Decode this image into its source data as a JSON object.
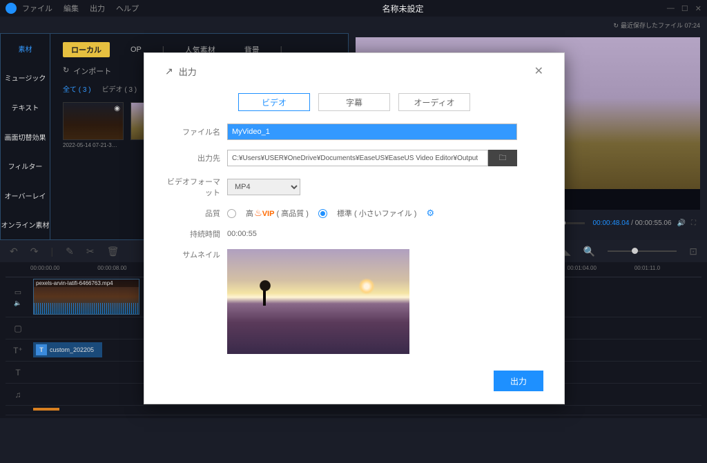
{
  "titlebar": {
    "menus": [
      "ファイル",
      "編集",
      "出力",
      "ヘルプ"
    ],
    "title": "名称未設定"
  },
  "toolbar": {
    "save_info": "最近保存したファイル 07:24"
  },
  "sidebar": {
    "items": [
      "素材",
      "ミュージック",
      "テキスト",
      "画面切替効果",
      "フィルター",
      "オーバーレイ",
      "オンライン素材"
    ]
  },
  "media": {
    "tabs": [
      "ローカル",
      "OP",
      "人気素材",
      "背景"
    ],
    "import_label": "インポート",
    "filter_all": "全て ( 3 )",
    "filter_video": "ビデオ ( 3 )",
    "thumb1_label": "2022-05-14 07-21-3…"
  },
  "preview": {
    "current_time": "00:00:48.04",
    "total_time": "00:00:55.06"
  },
  "ruler": [
    "00:00:00.00",
    "00:00:08.00",
    "",
    "",
    "",
    "",
    "",
    "",
    "00:01:04.00",
    "00:01:11.0"
  ],
  "timeline": {
    "clip_label": "pexels-arvin-latifi-6466763.mp4",
    "text_clip": "custom_202205"
  },
  "modal": {
    "header": "出力",
    "tabs": [
      "ビデオ",
      "字幕",
      "オーディオ"
    ],
    "labels": {
      "filename": "ファイル名",
      "output_path": "出力先",
      "format": "ビデオフォーマット",
      "quality": "品質",
      "duration": "持続時間",
      "thumbnail": "サムネイル"
    },
    "values": {
      "filename": "MyVideo_1",
      "output_path": "C:¥Users¥USER¥OneDrive¥Documents¥EaseUS¥EaseUS Video Editor¥Output",
      "format": "MP4",
      "quality_high": "高",
      "quality_high_suffix": "( 高品質 )",
      "quality_std": "標準 ( 小さいファイル )",
      "vip": "VIP",
      "duration": "00:00:55"
    },
    "export_btn": "出力"
  }
}
